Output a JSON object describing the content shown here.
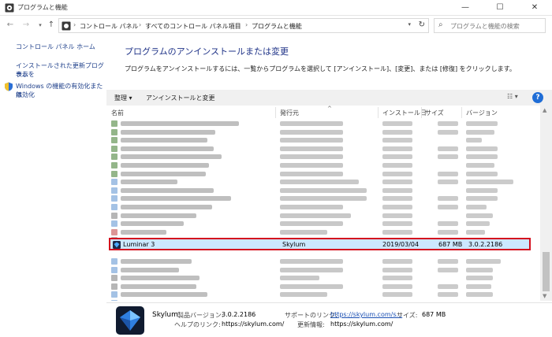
{
  "window": {
    "title": "プログラムと機能",
    "min": "—",
    "max": "☐",
    "close": "✕"
  },
  "address": {
    "crumbs": [
      "コントロール パネル",
      "すべてのコントロール パネル項目",
      "プログラムと機能"
    ],
    "search_placeholder": "プログラムと機能の検索"
  },
  "sidebar": {
    "home": "コントロール パネル ホーム",
    "updates_line1": "インストールされた更新プログラムを",
    "updates_line2": "表示",
    "features_line1": "Windows の機能の有効化または",
    "features_line2": "無効化"
  },
  "main": {
    "title": "プログラムのアンインストールまたは変更",
    "description": "プログラムをアンインストールするには、一覧からプログラムを選択して [アンインストール]、[変更]、または [修復] をクリックします。"
  },
  "toolbar": {
    "organize": "整理 ▾",
    "uninstall_change": "アンインストールと変更",
    "view": "☷ ▾",
    "help": "?"
  },
  "columns": {
    "name": "名前",
    "publisher": "発行元",
    "install_date": "インストール日",
    "size": "サイズ",
    "version": "バージョン"
  },
  "selected": {
    "name": "Luminar 3",
    "publisher": "Skylum",
    "install_date": "2019/03/04",
    "size": "687 MB",
    "version": "3.0.2.2186"
  },
  "details": {
    "publisher": "Skylum",
    "product_version_label": "製品バージョン:",
    "product_version": "3.0.2.2186",
    "support_link_label": "サポートのリンク:",
    "support_link": "https://skylum.com/s...",
    "size_label": "サイズ:",
    "size": "687 MB",
    "help_link_label": "ヘルプのリンク:",
    "help_link": "https://skylum.com/",
    "update_info_label": "更新情報:",
    "update_info": "https://skylum.com/"
  },
  "colors": {
    "accent": "#1e3287",
    "selection": "#cce8ff",
    "highlight_border": "#d40f1e"
  }
}
